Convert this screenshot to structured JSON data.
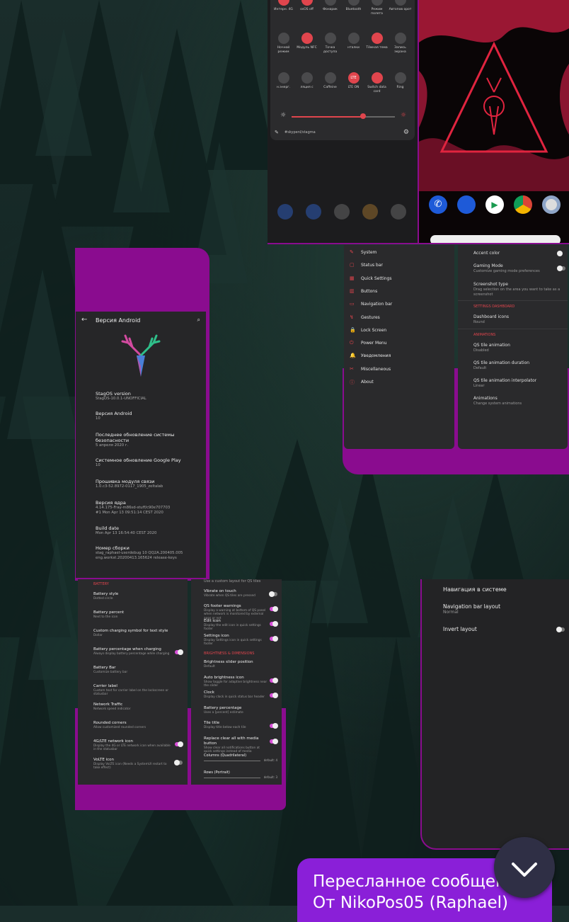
{
  "quick_settings": {
    "row1": [
      "Интерн. 4G",
      "osOS off",
      "Фонарик",
      "Bluetooth",
      "Режим полета",
      "Автопов орот"
    ],
    "row2": [
      "Ночной режим",
      "Модуль NFC",
      "Точка доступа",
      "нталки",
      "Тёмная тема",
      "Запись экрана"
    ],
    "row3": [
      "н.энерг.",
      "ляция с",
      "Caffeine",
      "LTE ON",
      "Switch data card",
      "Ring"
    ],
    "lte_badge": "LTE",
    "edit_label": "#skypenl/stagma"
  },
  "android_version": {
    "title": "Версия Android",
    "items": [
      {
        "t": "StagOS version",
        "s": "StagOS-10.0.1-UNOFFICIAL"
      },
      {
        "t": "Версия Android",
        "s": "10"
      },
      {
        "t": "Последнее обновление системы безопасности",
        "s": "5 апреля 2020 г."
      },
      {
        "t": "Системное обновление Google Play",
        "s": "10"
      },
      {
        "t": "Прошивка модуля связи",
        "s": "1.0.c3-52.8972-0117_1905_zeltalab"
      },
      {
        "t": "Версия ядра",
        "s": "4.14.175-Fray-m86sd-stuff/c90e707703\n#1 Mon Apr 13 09:51:14 CEST 2020"
      },
      {
        "t": "Build date",
        "s": "Mon Apr 13 16:54:40 CEST 2020"
      },
      {
        "t": "Номер сборки",
        "s": "stag_raphael-userdebug 10 QQ2A.200405.005\neng.workst.20200413.165624 release-keys"
      }
    ]
  },
  "settings_menu": {
    "items": [
      "System",
      "Status bar",
      "Quick Settings",
      "Buttons",
      "Navigation bar",
      "Gestures",
      "Lock Screen",
      "Power Menu",
      "Уведомления",
      "Miscellaneous",
      "About"
    ],
    "icon_colors": [
      "#e0454d",
      "#e0454d",
      "#e0454d",
      "#e0454d",
      "#e0454d",
      "#e0454d",
      "#e0454d",
      "#e0454d",
      "#e0454d",
      "#e0454d",
      "#e0454d"
    ]
  },
  "system_settings": {
    "accent": {
      "t": "Accent color"
    },
    "gaming": {
      "t": "Gaming Mode",
      "s": "Customize gaming mode preferences"
    },
    "screenshot": {
      "t": "Screenshot type",
      "s": "Drag selection on the area you want to take as a screenshot"
    },
    "section_dashboard": "SETTINGS DASHBOARD",
    "dashboard_icons": {
      "t": "Dashboard icons",
      "s": "Round"
    },
    "section_animations": "ANIMATIONS",
    "qs_anim": {
      "t": "QS tile animation",
      "s": "Disabled"
    },
    "qs_duration": {
      "t": "QS tile animation duration",
      "s": "Default"
    },
    "qs_interp": {
      "t": "QS tile animation interpolator",
      "s": "Linear"
    },
    "animations": {
      "t": "Animations",
      "s": "Change system animations"
    }
  },
  "battery_settings": {
    "section": "BATTERY",
    "items": [
      {
        "t": "Battery style",
        "s": "Dotted circle"
      },
      {
        "t": "Battery percent",
        "s": "Next to the icon"
      },
      {
        "t": "Custom charging symbol for text style",
        "s": "Dollar"
      },
      {
        "t": "Battery percentage when charging",
        "s": "Always display battery percentage while charging",
        "toggle": "on"
      },
      {
        "t": "Battery Bar",
        "s": "Customize battery bar"
      },
      {
        "t": "Carrier label",
        "s": "Custom text for carrier label on the lockscreen or statusbar"
      },
      {
        "t": "Network Traffic",
        "s": "Network speed indicator"
      },
      {
        "t": "Rounded corners",
        "s": "Allow customized rounded corners"
      },
      {
        "t": "4G/LTE network icon",
        "s": "Display the 4G or LTE network icon when available in the statusbar",
        "toggle": "on"
      },
      {
        "t": "VoLTE icon",
        "s": "Display VoLTE icon (Needs a SystemUI restart to take effect)",
        "toggle": "off"
      }
    ]
  },
  "qs_settings": {
    "top_text": "Use a custom layout for QS tiles",
    "items": [
      {
        "t": "Vibrate on touch",
        "s": "Vibrate when QS tiles are pressed",
        "toggle": "off"
      },
      {
        "t": "QS footer warnings",
        "s": "Display a warning at bottom of QS panel when network is monitored by external apps or not",
        "toggle": "on"
      },
      {
        "t": "Edit icon",
        "s": "Display the edit icon in quick settings footer",
        "toggle": "on"
      },
      {
        "t": "Settings icon",
        "s": "Display Settings icon in quick settings footer",
        "toggle": "on"
      }
    ],
    "section": "BRIGHTNESS & DIMENSIONS",
    "items2": [
      {
        "t": "Brightness slider position",
        "s": "Default"
      },
      {
        "t": "Auto brightness icon",
        "s": "Show toggle for adaptive brightness near the slider",
        "toggle": "on"
      },
      {
        "t": "Clock",
        "s": "Display clock in quick status bar header",
        "toggle": "on"
      },
      {
        "t": "Battery percentage",
        "s": "Uses a [percent] estimate"
      },
      {
        "t": "Tile title",
        "s": "Display title below each tile",
        "toggle": "on"
      },
      {
        "t": "Replace clear all with media button",
        "s": "Show clear all notifications button at quick settings instead of media",
        "toggle": "on"
      }
    ],
    "sliders": [
      {
        "t": "Columns (Quadrilateral)",
        "v": "default: 4"
      },
      {
        "t": "Rows (Portrait)",
        "v": "default: 3"
      }
    ]
  },
  "navigation": {
    "title": "Навигация в системе",
    "layout": {
      "t": "Navigation bar layout",
      "s": "Normal"
    },
    "invert": {
      "t": "Invert layout"
    }
  },
  "forward_bubble": {
    "line1": "Пересланное сообщение",
    "line2": "От NikoPos05 (Raphael)"
  },
  "colors": {
    "accent_purple": "#8a0c8f",
    "toggle_on": "#d84fd8",
    "red": "#e0454d"
  }
}
